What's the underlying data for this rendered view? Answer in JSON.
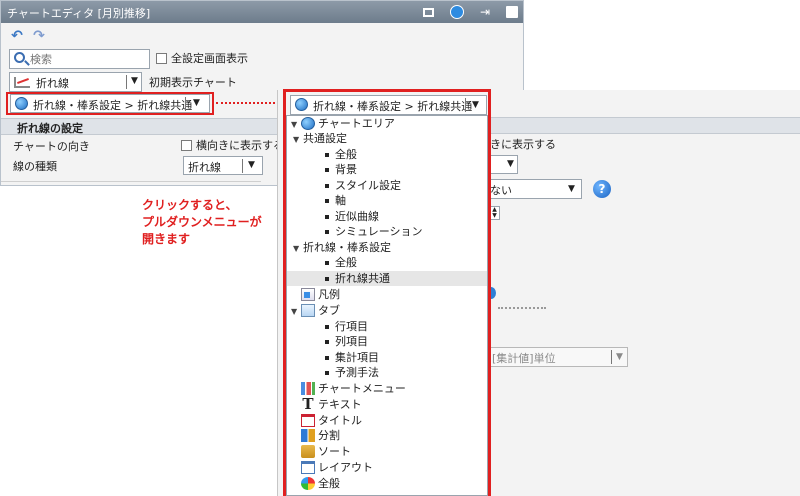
{
  "window": {
    "title": "チャートエディタ [月別推移]"
  },
  "search": {
    "placeholder": "検索"
  },
  "show_all_label": "全設定画面表示",
  "chart_type": {
    "value": "折れ線",
    "label": "初期表示チャート"
  },
  "category_select": {
    "value": "折れ線・棒系設定 > 折れ線共通"
  },
  "section": {
    "title": "折れ線の設定",
    "orientation_label": "チャートの向き",
    "horizontal_label": "横向きに表示する",
    "line_type_label": "線の種類",
    "line_type_value": "折れ線"
  },
  "annotation": {
    "line1": "クリックすると、",
    "line2": "プルダウンメニューが",
    "line3": "開きます"
  },
  "right_panel": {
    "horizontal_partial": "きに表示する",
    "nashi_partial": "ない",
    "unit_partial": "[集計値]単位",
    "help_icon": "?"
  },
  "tree": [
    {
      "label": "チャートエリア",
      "level": 0,
      "expander": "▼",
      "icon": "globe-icon"
    },
    {
      "label": "共通設定",
      "level": 1,
      "expander": "▼"
    },
    {
      "label": "全般",
      "level": 2
    },
    {
      "label": "背景",
      "level": 2
    },
    {
      "label": "スタイル設定",
      "level": 2
    },
    {
      "label": "軸",
      "level": 2
    },
    {
      "label": "近似曲線",
      "level": 2
    },
    {
      "label": "シミュレーション",
      "level": 2
    },
    {
      "label": "折れ線・棒系設定",
      "level": 1,
      "expander": "▼"
    },
    {
      "label": "全般",
      "level": 2
    },
    {
      "label": "折れ線共通",
      "level": 2,
      "selected": true
    },
    {
      "label": "凡例",
      "level": 0,
      "icon": "legend-icon"
    },
    {
      "label": "タブ",
      "level": 0,
      "expander": "▼",
      "icon": "tab-icon"
    },
    {
      "label": "行項目",
      "level": 1
    },
    {
      "label": "列項目",
      "level": 1
    },
    {
      "label": "集計項目",
      "level": 1
    },
    {
      "label": "予測手法",
      "level": 1
    },
    {
      "label": "チャートメニュー",
      "level": 0,
      "icon": "chart-menu-icon"
    },
    {
      "label": "テキスト",
      "level": 0,
      "icon": "text-icon"
    },
    {
      "label": "タイトル",
      "level": 0,
      "icon": "title-icon"
    },
    {
      "label": "分割",
      "level": 0,
      "icon": "split-icon"
    },
    {
      "label": "ソート",
      "level": 0,
      "icon": "sort-icon"
    },
    {
      "label": "レイアウト",
      "level": 0,
      "icon": "layout-icon"
    },
    {
      "label": "全般",
      "level": 0,
      "icon": "all-settings-icon"
    }
  ],
  "colors": {
    "highlight_red": "#e02020",
    "titlebar": "#7b8896",
    "section_bg": "#dfe3e8"
  }
}
